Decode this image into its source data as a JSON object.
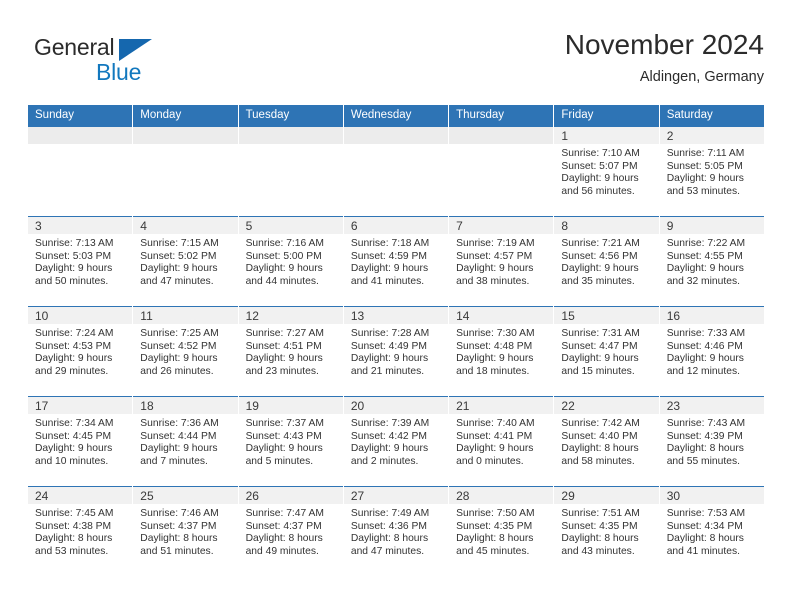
{
  "brand": {
    "name_top": "General",
    "name_bottom": "Blue",
    "triangle_color": "#1567ae",
    "blue_text_color": "#1278be"
  },
  "header": {
    "month_title": "November 2024",
    "location": "Aldingen, Germany"
  },
  "theme": {
    "header_blue": "#2e74b5",
    "daynum_band": "#f1f1f1",
    "empty_band": "#ececec"
  },
  "calendar": {
    "day_headers": [
      "Sunday",
      "Monday",
      "Tuesday",
      "Wednesday",
      "Thursday",
      "Friday",
      "Saturday"
    ],
    "weeks": [
      [
        {
          "day": "",
          "empty": true,
          "lines": []
        },
        {
          "day": "",
          "empty": true,
          "lines": []
        },
        {
          "day": "",
          "empty": true,
          "lines": []
        },
        {
          "day": "",
          "empty": true,
          "lines": []
        },
        {
          "day": "",
          "empty": true,
          "lines": []
        },
        {
          "day": "1",
          "empty": false,
          "lines": [
            "Sunrise: 7:10 AM",
            "Sunset: 5:07 PM",
            "Daylight: 9 hours",
            "and 56 minutes."
          ]
        },
        {
          "day": "2",
          "empty": false,
          "lines": [
            "Sunrise: 7:11 AM",
            "Sunset: 5:05 PM",
            "Daylight: 9 hours",
            "and 53 minutes."
          ]
        }
      ],
      [
        {
          "day": "3",
          "empty": false,
          "lines": [
            "Sunrise: 7:13 AM",
            "Sunset: 5:03 PM",
            "Daylight: 9 hours",
            "and 50 minutes."
          ]
        },
        {
          "day": "4",
          "empty": false,
          "lines": [
            "Sunrise: 7:15 AM",
            "Sunset: 5:02 PM",
            "Daylight: 9 hours",
            "and 47 minutes."
          ]
        },
        {
          "day": "5",
          "empty": false,
          "lines": [
            "Sunrise: 7:16 AM",
            "Sunset: 5:00 PM",
            "Daylight: 9 hours",
            "and 44 minutes."
          ]
        },
        {
          "day": "6",
          "empty": false,
          "lines": [
            "Sunrise: 7:18 AM",
            "Sunset: 4:59 PM",
            "Daylight: 9 hours",
            "and 41 minutes."
          ]
        },
        {
          "day": "7",
          "empty": false,
          "lines": [
            "Sunrise: 7:19 AM",
            "Sunset: 4:57 PM",
            "Daylight: 9 hours",
            "and 38 minutes."
          ]
        },
        {
          "day": "8",
          "empty": false,
          "lines": [
            "Sunrise: 7:21 AM",
            "Sunset: 4:56 PM",
            "Daylight: 9 hours",
            "and 35 minutes."
          ]
        },
        {
          "day": "9",
          "empty": false,
          "lines": [
            "Sunrise: 7:22 AM",
            "Sunset: 4:55 PM",
            "Daylight: 9 hours",
            "and 32 minutes."
          ]
        }
      ],
      [
        {
          "day": "10",
          "empty": false,
          "lines": [
            "Sunrise: 7:24 AM",
            "Sunset: 4:53 PM",
            "Daylight: 9 hours",
            "and 29 minutes."
          ]
        },
        {
          "day": "11",
          "empty": false,
          "lines": [
            "Sunrise: 7:25 AM",
            "Sunset: 4:52 PM",
            "Daylight: 9 hours",
            "and 26 minutes."
          ]
        },
        {
          "day": "12",
          "empty": false,
          "lines": [
            "Sunrise: 7:27 AM",
            "Sunset: 4:51 PM",
            "Daylight: 9 hours",
            "and 23 minutes."
          ]
        },
        {
          "day": "13",
          "empty": false,
          "lines": [
            "Sunrise: 7:28 AM",
            "Sunset: 4:49 PM",
            "Daylight: 9 hours",
            "and 21 minutes."
          ]
        },
        {
          "day": "14",
          "empty": false,
          "lines": [
            "Sunrise: 7:30 AM",
            "Sunset: 4:48 PM",
            "Daylight: 9 hours",
            "and 18 minutes."
          ]
        },
        {
          "day": "15",
          "empty": false,
          "lines": [
            "Sunrise: 7:31 AM",
            "Sunset: 4:47 PM",
            "Daylight: 9 hours",
            "and 15 minutes."
          ]
        },
        {
          "day": "16",
          "empty": false,
          "lines": [
            "Sunrise: 7:33 AM",
            "Sunset: 4:46 PM",
            "Daylight: 9 hours",
            "and 12 minutes."
          ]
        }
      ],
      [
        {
          "day": "17",
          "empty": false,
          "lines": [
            "Sunrise: 7:34 AM",
            "Sunset: 4:45 PM",
            "Daylight: 9 hours",
            "and 10 minutes."
          ]
        },
        {
          "day": "18",
          "empty": false,
          "lines": [
            "Sunrise: 7:36 AM",
            "Sunset: 4:44 PM",
            "Daylight: 9 hours",
            "and 7 minutes."
          ]
        },
        {
          "day": "19",
          "empty": false,
          "lines": [
            "Sunrise: 7:37 AM",
            "Sunset: 4:43 PM",
            "Daylight: 9 hours",
            "and 5 minutes."
          ]
        },
        {
          "day": "20",
          "empty": false,
          "lines": [
            "Sunrise: 7:39 AM",
            "Sunset: 4:42 PM",
            "Daylight: 9 hours",
            "and 2 minutes."
          ]
        },
        {
          "day": "21",
          "empty": false,
          "lines": [
            "Sunrise: 7:40 AM",
            "Sunset: 4:41 PM",
            "Daylight: 9 hours",
            "and 0 minutes."
          ]
        },
        {
          "day": "22",
          "empty": false,
          "lines": [
            "Sunrise: 7:42 AM",
            "Sunset: 4:40 PM",
            "Daylight: 8 hours",
            "and 58 minutes."
          ]
        },
        {
          "day": "23",
          "empty": false,
          "lines": [
            "Sunrise: 7:43 AM",
            "Sunset: 4:39 PM",
            "Daylight: 8 hours",
            "and 55 minutes."
          ]
        }
      ],
      [
        {
          "day": "24",
          "empty": false,
          "lines": [
            "Sunrise: 7:45 AM",
            "Sunset: 4:38 PM",
            "Daylight: 8 hours",
            "and 53 minutes."
          ]
        },
        {
          "day": "25",
          "empty": false,
          "lines": [
            "Sunrise: 7:46 AM",
            "Sunset: 4:37 PM",
            "Daylight: 8 hours",
            "and 51 minutes."
          ]
        },
        {
          "day": "26",
          "empty": false,
          "lines": [
            "Sunrise: 7:47 AM",
            "Sunset: 4:37 PM",
            "Daylight: 8 hours",
            "and 49 minutes."
          ]
        },
        {
          "day": "27",
          "empty": false,
          "lines": [
            "Sunrise: 7:49 AM",
            "Sunset: 4:36 PM",
            "Daylight: 8 hours",
            "and 47 minutes."
          ]
        },
        {
          "day": "28",
          "empty": false,
          "lines": [
            "Sunrise: 7:50 AM",
            "Sunset: 4:35 PM",
            "Daylight: 8 hours",
            "and 45 minutes."
          ]
        },
        {
          "day": "29",
          "empty": false,
          "lines": [
            "Sunrise: 7:51 AM",
            "Sunset: 4:35 PM",
            "Daylight: 8 hours",
            "and 43 minutes."
          ]
        },
        {
          "day": "30",
          "empty": false,
          "lines": [
            "Sunrise: 7:53 AM",
            "Sunset: 4:34 PM",
            "Daylight: 8 hours",
            "and 41 minutes."
          ]
        }
      ]
    ]
  }
}
